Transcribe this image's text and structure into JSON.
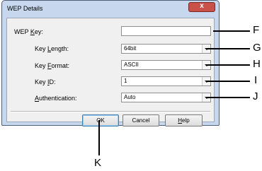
{
  "dialog": {
    "title": "WEP Details",
    "close_glyph": "x"
  },
  "fields": {
    "wep_key": {
      "label_pre": "WEP ",
      "label_u": "K",
      "label_post": "ey:",
      "value": ""
    },
    "key_length": {
      "label_pre": "Key ",
      "label_u": "L",
      "label_post": "ength:",
      "value": "64bit"
    },
    "key_format": {
      "label_pre": "Key ",
      "label_u": "F",
      "label_post": "ormat:",
      "value": "ASCII"
    },
    "key_id": {
      "label_pre": "Key ",
      "label_u": "I",
      "label_post": "D:",
      "value": "1"
    },
    "authentication": {
      "label_pre": "",
      "label_u": "A",
      "label_post": "uthentication:",
      "value": "Auto"
    }
  },
  "buttons": {
    "ok": "OK",
    "cancel": "Cancel",
    "help_u": "H",
    "help_post": "elp"
  },
  "callouts": {
    "F": "F",
    "G": "G",
    "H": "H",
    "I": "I",
    "J": "J",
    "K": "K"
  }
}
